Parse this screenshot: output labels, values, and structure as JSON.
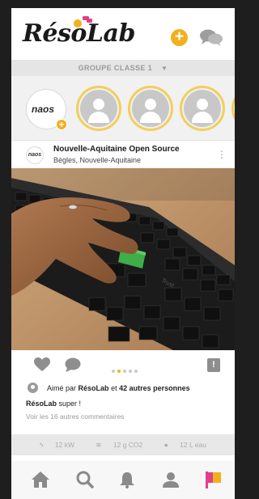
{
  "header": {
    "logo_text": "RésoLab",
    "add_icon": "plus-circle-icon",
    "chat_icon": "chat-bubbles-icon"
  },
  "group_selector": {
    "label": "GROUPE CLASSE 1",
    "caret": "▼"
  },
  "stories": {
    "own": {
      "label": "naos",
      "add_icon": "plus-icon"
    },
    "others_count": 4
  },
  "post": {
    "author": "Nouvelle-Aquitaine Open Source",
    "location": "Bègles, Nouvelle-Aquitaine",
    "avatar_text": "naos",
    "image_alt": "Hand typing on a black keyboard with a green key",
    "carousel": {
      "count": 5,
      "active_index": 1
    },
    "likes": {
      "prefix": "Aimé par",
      "first_user": "RésoLab",
      "middle": "et",
      "others": "42 autres personnes"
    },
    "comment": {
      "author": "RésoLab",
      "text": "super !"
    },
    "see_all_comments": "Voir les 16 autres commentaires"
  },
  "footer_stats": {
    "energy": "12 kW",
    "co2": "12 g CO2",
    "water": "12 L eau"
  },
  "tabbar": {
    "items": [
      "home-icon",
      "search-icon",
      "bell-icon",
      "user-icon",
      "flag-icon"
    ]
  },
  "colors": {
    "accent": "#f2b01e",
    "story_ring": "#f1cf5a",
    "key_green": "#3fae49"
  }
}
